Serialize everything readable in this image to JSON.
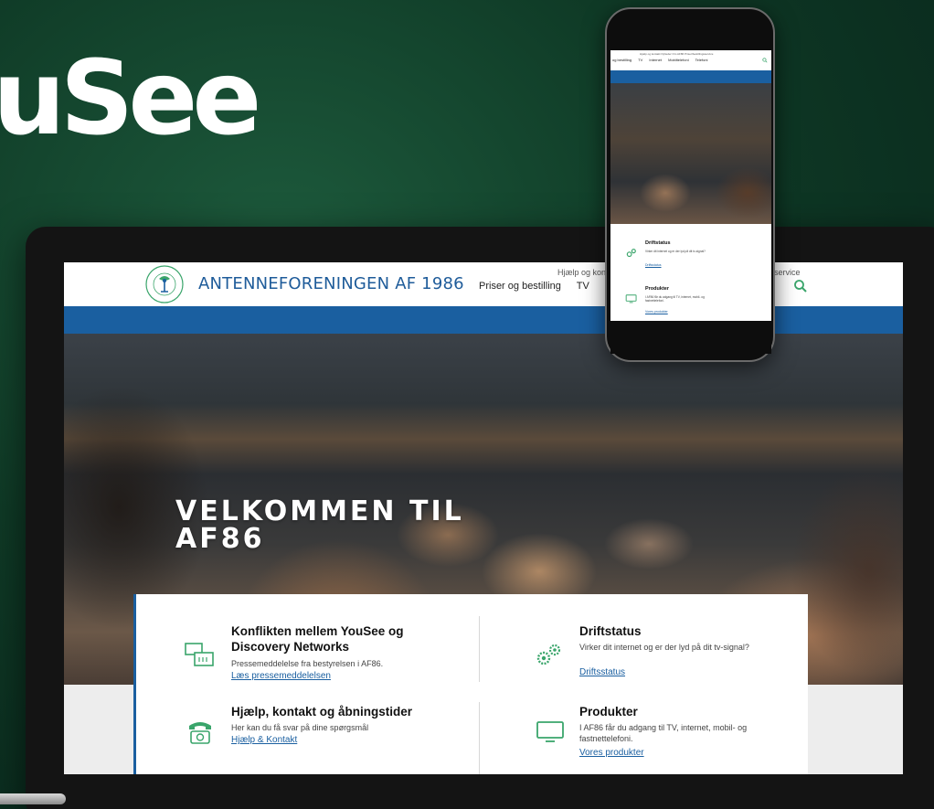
{
  "brand": {
    "logo_text": "uSee"
  },
  "site": {
    "name": "ANTENNEFORENINGEN AF 1986",
    "top_links": [
      "Hjælp og kontakt",
      "",
      "ssservice"
    ],
    "nav": [
      "Priser og bestilling",
      "TV",
      "",
      "i"
    ],
    "hero_title_line1": "VELKOMMEN TIL",
    "hero_title_line2": "AF86"
  },
  "cards": [
    {
      "title": "Konflikten mellem YouSee og Discovery Networks",
      "text": "Pressemeddelelse fra bestyrelsen i AF86.",
      "link": "Læs pressemeddelelsen",
      "icon": "screens-icon"
    },
    {
      "title": "Driftstatus",
      "text": "Virker dit internet og er der lyd på dit tv-signal?",
      "link": "Driftsstatus",
      "icon": "gears-icon"
    },
    {
      "title": "Hjælp, kontakt og åbningstider",
      "text": "Her kan du få svar på dine spørgsmål",
      "link": "Hjælp & Kontakt",
      "icon": "telephone-icon"
    },
    {
      "title": "Produkter",
      "text": "I AF86 får du adgang til TV, internet, mobil- og fastnettelefoni.",
      "link": "Vores produkter",
      "icon": "monitor-icon"
    }
  ],
  "phone": {
    "top_links": "Hjælp og kontakt   Nyheder   Om AF86   Priser/bestillingsservice",
    "nav": [
      "og bestilling",
      "TV",
      "Internet",
      "Mobiltelefoni",
      "Telefoni"
    ],
    "cards": [
      {
        "title": "Driftstatus",
        "text": "Virker dit internet og er der lyd på dit tv-signal?",
        "link": "Driftsstatus"
      },
      {
        "title": "Produkter",
        "text": "I AF86 får du adgang til TV, internet, mobil- og fastnettelefoni.",
        "link": "Vores produkter"
      }
    ]
  },
  "colors": {
    "brand_blue": "#1a5fa0",
    "background_green": "#0f3a26",
    "accent_green": "#3aa56b"
  }
}
